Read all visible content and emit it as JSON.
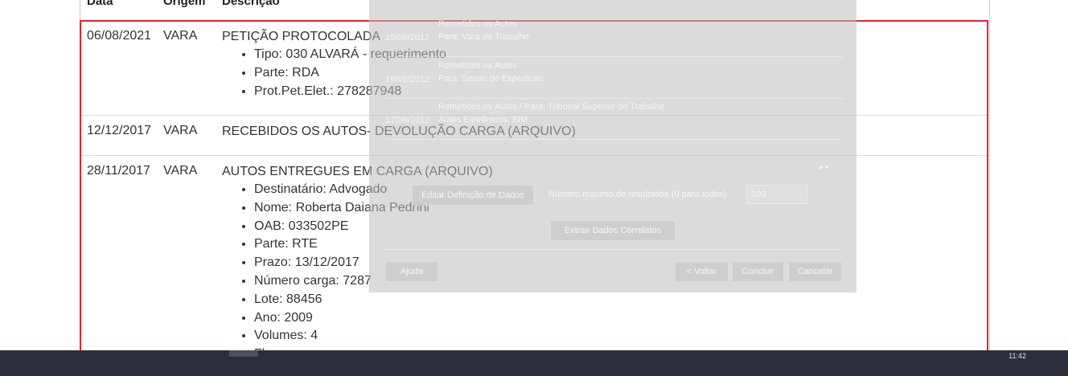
{
  "table": {
    "headers": [
      "Data",
      "Origem",
      "Descrição"
    ],
    "rows": [
      {
        "date": "06/08/2021",
        "origin": "VARA",
        "title": "PETIÇÃO PROTOCOLADA",
        "items": [
          "Tipo: 030 ALVARÁ - requerimento",
          "Parte: RDA",
          "Prot.Pet.Elet.: 278287948"
        ]
      },
      {
        "date": "12/12/2017",
        "origin": "VARA",
        "title": "RECEBIDOS OS AUTOS- DEVOLUÇÃO CARGA (ARQUIVO)",
        "items": []
      },
      {
        "date": "28/11/2017",
        "origin": "VARA",
        "title": "AUTOS ENTREGUES EM CARGA (ARQUIVO)",
        "items": [
          "Destinatário: Advogado",
          "Nome: Roberta Daiana Pedrini",
          "OAB: 033502PE",
          "Parte: RTE",
          "Prazo: 13/12/2017",
          "Número carga: 7287",
          "Lote: 88456",
          "Ano: 2009",
          "Volumes: 4",
          "Fl"
        ]
      }
    ]
  },
  "overlay": {
    "entries": [
      {
        "date": "19/09/2012",
        "line1": "Remetidos os Autos",
        "line2": "Para: Vara do Trabalho"
      },
      {
        "date": "19/09/2012",
        "line1": "Remetidos os Autos",
        "line2": "Para: Secao de Expedicao"
      },
      {
        "date": "17/09/2012",
        "line1": "Remetidos os Autos / Para: Tribunal Superior do Trabalho",
        "line2": "Autos Eletrônicos: SIM"
      }
    ],
    "edit_data_button": "Editar Definição de Dados",
    "max_results_label": "Número máximo de resultados (0 para todos)",
    "max_results_value": "100",
    "extract_button": "Extrair Dados Correlatos",
    "help_button": "Ajuda",
    "back_button": "< Voltar",
    "finish_button": "Concluir",
    "cancel_button": "Cancelar",
    "scroll_arrows": "▸ ▾"
  },
  "taskbar": {
    "clock": "11:42"
  },
  "colors": {
    "highlight": "#e0242c",
    "taskbar": "#2b2f3a"
  }
}
